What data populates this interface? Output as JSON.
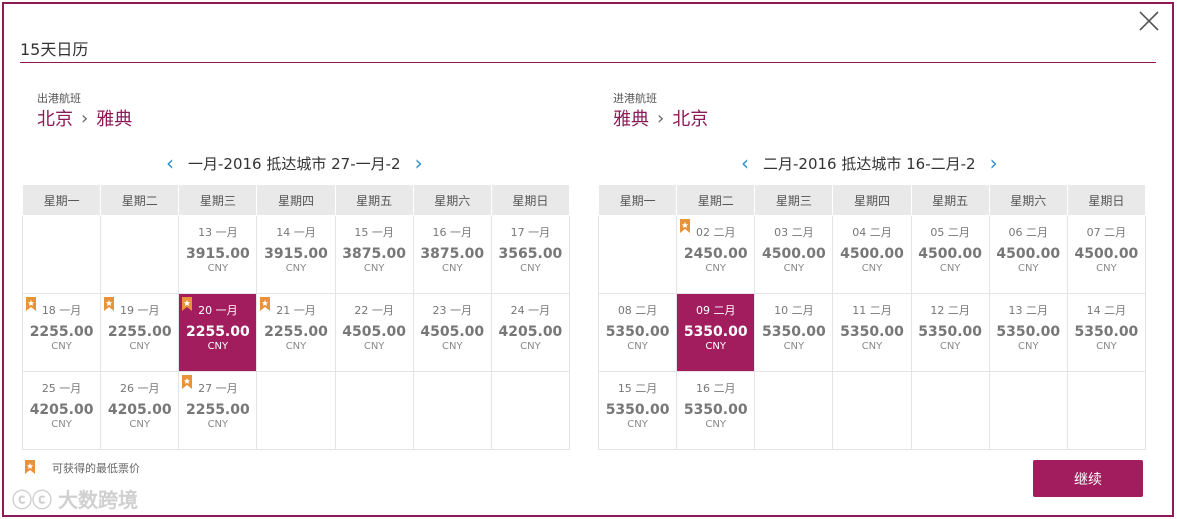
{
  "dialog": {
    "title": "15天日历",
    "close_icon": "close-icon"
  },
  "outbound": {
    "caption": "出港航班",
    "from": "北京",
    "to": "雅典",
    "month_label": "一月-2016 抵达城市 27-一月-2",
    "weekdays": [
      "星期一",
      "星期二",
      "星期三",
      "星期四",
      "星期五",
      "星期六",
      "星期日"
    ],
    "rows": [
      [
        null,
        null,
        {
          "date": "13 一月",
          "price": "3915.00",
          "currency": "CNY",
          "lowest": false,
          "selected": false
        },
        {
          "date": "14 一月",
          "price": "3915.00",
          "currency": "CNY",
          "lowest": false,
          "selected": false
        },
        {
          "date": "15 一月",
          "price": "3875.00",
          "currency": "CNY",
          "lowest": false,
          "selected": false
        },
        {
          "date": "16 一月",
          "price": "3875.00",
          "currency": "CNY",
          "lowest": false,
          "selected": false
        },
        {
          "date": "17 一月",
          "price": "3565.00",
          "currency": "CNY",
          "lowest": false,
          "selected": false
        }
      ],
      [
        {
          "date": "18 一月",
          "price": "2255.00",
          "currency": "CNY",
          "lowest": true,
          "selected": false
        },
        {
          "date": "19 一月",
          "price": "2255.00",
          "currency": "CNY",
          "lowest": true,
          "selected": false
        },
        {
          "date": "20 一月",
          "price": "2255.00",
          "currency": "CNY",
          "lowest": true,
          "selected": true
        },
        {
          "date": "21 一月",
          "price": "2255.00",
          "currency": "CNY",
          "lowest": true,
          "selected": false
        },
        {
          "date": "22 一月",
          "price": "4505.00",
          "currency": "CNY",
          "lowest": false,
          "selected": false
        },
        {
          "date": "23 一月",
          "price": "4505.00",
          "currency": "CNY",
          "lowest": false,
          "selected": false
        },
        {
          "date": "24 一月",
          "price": "4205.00",
          "currency": "CNY",
          "lowest": false,
          "selected": false
        }
      ],
      [
        {
          "date": "25 一月",
          "price": "4205.00",
          "currency": "CNY",
          "lowest": false,
          "selected": false
        },
        {
          "date": "26 一月",
          "price": "4205.00",
          "currency": "CNY",
          "lowest": false,
          "selected": false
        },
        {
          "date": "27 一月",
          "price": "2255.00",
          "currency": "CNY",
          "lowest": true,
          "selected": false
        },
        null,
        null,
        null,
        null
      ]
    ]
  },
  "inbound": {
    "caption": "进港航班",
    "from": "雅典",
    "to": "北京",
    "month_label": "二月-2016 抵达城市 16-二月-2",
    "weekdays": [
      "星期一",
      "星期二",
      "星期三",
      "星期四",
      "星期五",
      "星期六",
      "星期日"
    ],
    "rows": [
      [
        null,
        {
          "date": "02 二月",
          "price": "2450.00",
          "currency": "CNY",
          "lowest": true,
          "selected": false
        },
        {
          "date": "03 二月",
          "price": "4500.00",
          "currency": "CNY",
          "lowest": false,
          "selected": false
        },
        {
          "date": "04 二月",
          "price": "4500.00",
          "currency": "CNY",
          "lowest": false,
          "selected": false
        },
        {
          "date": "05 二月",
          "price": "4500.00",
          "currency": "CNY",
          "lowest": false,
          "selected": false
        },
        {
          "date": "06 二月",
          "price": "4500.00",
          "currency": "CNY",
          "lowest": false,
          "selected": false
        },
        {
          "date": "07 二月",
          "price": "4500.00",
          "currency": "CNY",
          "lowest": false,
          "selected": false
        }
      ],
      [
        {
          "date": "08 二月",
          "price": "5350.00",
          "currency": "CNY",
          "lowest": false,
          "selected": false
        },
        {
          "date": "09 二月",
          "price": "5350.00",
          "currency": "CNY",
          "lowest": false,
          "selected": true
        },
        {
          "date": "10 二月",
          "price": "5350.00",
          "currency": "CNY",
          "lowest": false,
          "selected": false
        },
        {
          "date": "11 二月",
          "price": "5350.00",
          "currency": "CNY",
          "lowest": false,
          "selected": false
        },
        {
          "date": "12 二月",
          "price": "5350.00",
          "currency": "CNY",
          "lowest": false,
          "selected": false
        },
        {
          "date": "13 二月",
          "price": "5350.00",
          "currency": "CNY",
          "lowest": false,
          "selected": false
        },
        {
          "date": "14 二月",
          "price": "5350.00",
          "currency": "CNY",
          "lowest": false,
          "selected": false
        }
      ],
      [
        {
          "date": "15 二月",
          "price": "5350.00",
          "currency": "CNY",
          "lowest": false,
          "selected": false
        },
        {
          "date": "16 二月",
          "price": "5350.00",
          "currency": "CNY",
          "lowest": false,
          "selected": false
        },
        null,
        null,
        null,
        null,
        null
      ]
    ]
  },
  "legend": {
    "icon": "bookmark-flag-icon",
    "text": "可获得的最低票价"
  },
  "actions": {
    "continue_label": "继续"
  },
  "watermark": {
    "text": "大数跨境"
  },
  "colors": {
    "brand": "#8b1a57",
    "selected": "#a11d5d",
    "lowest_flag": "#e8933a",
    "nav_arrow": "#2a8fc9"
  }
}
